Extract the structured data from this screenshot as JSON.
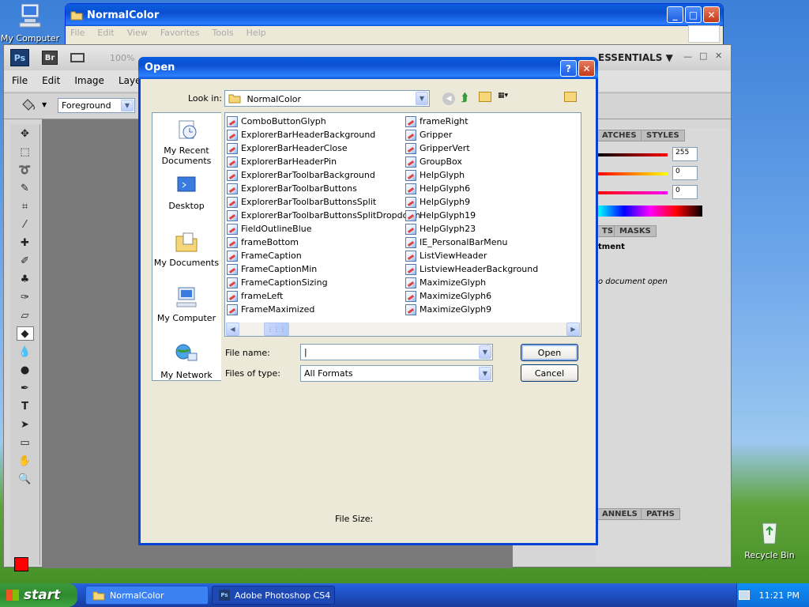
{
  "desktop": {
    "my_computer": "My Computer",
    "recycle_bin": "Recycle Bin"
  },
  "explorer": {
    "title": "NormalColor",
    "menu": [
      "File",
      "Edit",
      "View",
      "Favorites",
      "Tools",
      "Help"
    ]
  },
  "photoshop": {
    "logo": "Ps",
    "bridge": "Br",
    "zoom": "100%",
    "workspace": "ESSENTIALS",
    "menu": [
      "File",
      "Edit",
      "Image",
      "Layer"
    ],
    "fill_source": "Foreground",
    "swatch_tabs": [
      "ATCHES",
      "STYLES"
    ],
    "adjust_tabs": [
      "TS",
      "MASKS"
    ],
    "adjust_title": "tment",
    "no_document": "o document open",
    "channel_tabs": [
      "ANNELS",
      "PATHS"
    ],
    "color_values": [
      "255",
      "0",
      "0"
    ],
    "foreground_color": "#ff0000"
  },
  "dialog": {
    "title": "Open",
    "look_in_label": "Look in:",
    "look_in_value": "NormalColor",
    "places": [
      "My Recent Documents",
      "Desktop",
      "My Documents",
      "My Computer",
      "My Network"
    ],
    "files_col1": [
      "ComboButtonGlyph",
      "ExplorerBarHeaderBackground",
      "ExplorerBarHeaderClose",
      "ExplorerBarHeaderPin",
      "ExplorerBarToolbarBackground",
      "ExplorerBarToolbarButtons",
      "ExplorerBarToolbarButtonsSplit",
      "ExplorerBarToolbarButtonsSplitDropdown",
      "FieldOutlineBlue",
      "frameBottom",
      "FrameCaption",
      "FrameCaptionMin",
      "FrameCaptionSizing",
      "frameLeft",
      "FrameMaximized"
    ],
    "files_col2": [
      "frameRight",
      "Gripper",
      "GripperVert",
      "GroupBox",
      "HelpGlyph",
      "HelpGlyph6",
      "HelpGlyph9",
      "HelpGlyph19",
      "HelpGlyph23",
      "IE_PersonalBarMenu",
      "ListViewHeader",
      "ListviewHeaderBackground",
      "MaximizeGlyph",
      "MaximizeGlyph6",
      "MaximizeGlyph9"
    ],
    "file_name_label": "File name:",
    "file_name_value": "",
    "file_type_label": "Files of type:",
    "file_type_value": "All Formats",
    "open_button": "Open",
    "cancel_button": "Cancel",
    "file_size_label": "File Size:"
  },
  "taskbar": {
    "start": "start",
    "tasks": [
      "NormalColor",
      "Adobe Photoshop CS4"
    ],
    "clock": "11:21 PM"
  }
}
